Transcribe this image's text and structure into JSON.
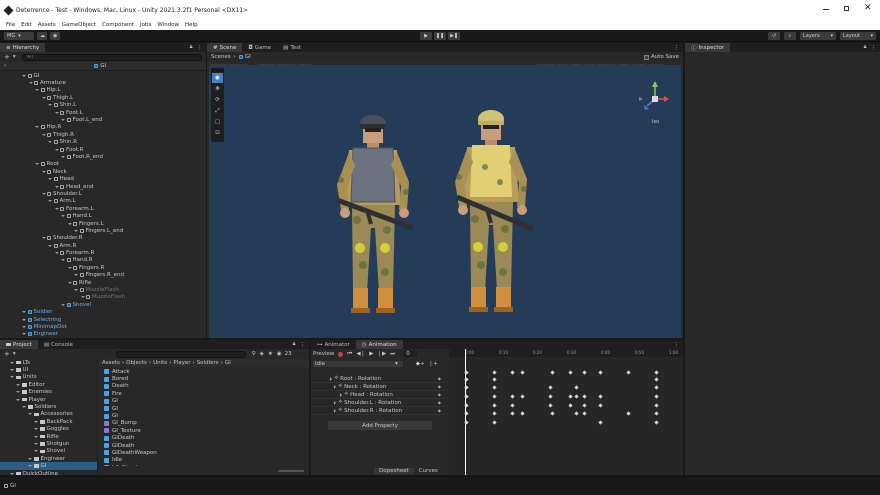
{
  "window": {
    "title": "Deterrence - Test - Windows, Mac, Linux - Unity 2021.3.2f1 Personal <DX11>"
  },
  "menu": [
    "File",
    "Edit",
    "Assets",
    "GameObject",
    "Component",
    "Jobs",
    "Window",
    "Help"
  ],
  "toolbar": {
    "account": "MG",
    "layers": "Layers",
    "layout": "Layout"
  },
  "hierarchy": {
    "tab": "Hierarchy",
    "search_placeholder": "All",
    "scene": "GI",
    "items": [
      {
        "label": "GI",
        "indent": 0,
        "icon": "cube",
        "style": ""
      },
      {
        "label": "Armature",
        "indent": 1,
        "icon": "cube",
        "style": ""
      },
      {
        "label": "Hip.L",
        "indent": 2,
        "icon": "cube",
        "style": ""
      },
      {
        "label": "Thigh.L",
        "indent": 3,
        "icon": "cube",
        "style": ""
      },
      {
        "label": "Shin.L",
        "indent": 4,
        "icon": "cube",
        "style": ""
      },
      {
        "label": "Foot.L",
        "indent": 5,
        "icon": "cube",
        "style": ""
      },
      {
        "label": "Foot.L_end",
        "indent": 6,
        "icon": "cube",
        "style": ""
      },
      {
        "label": "Hip.R",
        "indent": 2,
        "icon": "cube",
        "style": ""
      },
      {
        "label": "Thigh.R",
        "indent": 3,
        "icon": "cube",
        "style": ""
      },
      {
        "label": "Shin.R",
        "indent": 4,
        "icon": "cube",
        "style": ""
      },
      {
        "label": "Foot.R",
        "indent": 5,
        "icon": "cube",
        "style": ""
      },
      {
        "label": "Foot.R_end",
        "indent": 6,
        "icon": "cube",
        "style": ""
      },
      {
        "label": "Root",
        "indent": 2,
        "icon": "cube",
        "style": ""
      },
      {
        "label": "Neck",
        "indent": 3,
        "icon": "cube",
        "style": ""
      },
      {
        "label": "Head",
        "indent": 4,
        "icon": "cube",
        "style": ""
      },
      {
        "label": "Head_end",
        "indent": 5,
        "icon": "cube",
        "style": ""
      },
      {
        "label": "Shoulder.L",
        "indent": 3,
        "icon": "cube",
        "style": ""
      },
      {
        "label": "Arm.L",
        "indent": 4,
        "icon": "cube",
        "style": ""
      },
      {
        "label": "Forearm.L",
        "indent": 5,
        "icon": "cube",
        "style": ""
      },
      {
        "label": "Hand.L",
        "indent": 6,
        "icon": "cube",
        "style": ""
      },
      {
        "label": "Fingers.L",
        "indent": 7,
        "icon": "cube",
        "style": ""
      },
      {
        "label": "Fingers.L_end",
        "indent": 8,
        "icon": "cube",
        "style": ""
      },
      {
        "label": "Shoulder.R",
        "indent": 3,
        "icon": "cube",
        "style": ""
      },
      {
        "label": "Arm.R",
        "indent": 4,
        "icon": "cube",
        "style": ""
      },
      {
        "label": "Forearm.R",
        "indent": 5,
        "icon": "cube",
        "style": ""
      },
      {
        "label": "Hand.R",
        "indent": 6,
        "icon": "cube",
        "style": ""
      },
      {
        "label": "Fingers.R",
        "indent": 7,
        "icon": "cube",
        "style": ""
      },
      {
        "label": "Fingers.R_end",
        "indent": 8,
        "icon": "cube",
        "style": ""
      },
      {
        "label": "Rifle",
        "indent": 7,
        "icon": "cube",
        "style": ""
      },
      {
        "label": "MuzzleFlash",
        "indent": 8,
        "icon": "cube",
        "style": "dim"
      },
      {
        "label": "MuzzleFlash",
        "indent": 9,
        "icon": "cube",
        "style": "dim"
      },
      {
        "label": "Shovel",
        "indent": 6,
        "icon": "cube",
        "style": "blue"
      },
      {
        "label": "Soldier",
        "indent": 0,
        "icon": "cube",
        "style": "blue"
      },
      {
        "label": "Selectring",
        "indent": 0,
        "icon": "cube",
        "style": "blue"
      },
      {
        "label": "MinimapDot",
        "indent": 0,
        "icon": "cube",
        "style": "blue"
      },
      {
        "label": "Engineer",
        "indent": 0,
        "icon": "cube",
        "style": "blue"
      }
    ]
  },
  "scene": {
    "tabs": [
      "Scene",
      "Game",
      "Test"
    ],
    "breadcrumb": [
      "Scenes",
      "GI"
    ],
    "autosave": "Auto Save",
    "gizmo_label": "Iso"
  },
  "inspector": {
    "tab": "Inspector"
  },
  "project": {
    "tabs": [
      "Project",
      "Console"
    ],
    "tree": [
      {
        "label": "LTs",
        "indent": 1,
        "open": false
      },
      {
        "label": "UI",
        "indent": 1,
        "open": false
      },
      {
        "label": "Units",
        "indent": 1,
        "open": true
      },
      {
        "label": "Editor",
        "indent": 2,
        "open": false
      },
      {
        "label": "Enemies",
        "indent": 2,
        "open": false
      },
      {
        "label": "Player",
        "indent": 2,
        "open": true
      },
      {
        "label": "Soldiers",
        "indent": 3,
        "open": true
      },
      {
        "label": "Accessories",
        "indent": 4,
        "open": true
      },
      {
        "label": "BackPack",
        "indent": 5,
        "open": false
      },
      {
        "label": "Goggles",
        "indent": 5,
        "open": false
      },
      {
        "label": "Rifle",
        "indent": 5,
        "open": false
      },
      {
        "label": "Shotgun",
        "indent": 5,
        "open": false
      },
      {
        "label": "Shovel",
        "indent": 5,
        "open": false
      },
      {
        "label": "Engineer",
        "indent": 4,
        "open": false
      },
      {
        "label": "GI",
        "indent": 4,
        "open": false
      },
      {
        "label": "QuickOutline",
        "indent": 1,
        "open": false
      }
    ],
    "path": [
      "Assets",
      "Objects",
      "Units",
      "Player",
      "Soldiers",
      "GI"
    ],
    "files": [
      "Attack",
      "Bored",
      "Death",
      "Fire",
      "GI",
      "GI",
      "GI",
      "GI_Bump",
      "GI_Texture",
      "GIDeath",
      "GIDeath",
      "GIDeathWeapon",
      "Idle",
      "IdleShoot"
    ],
    "count": "23",
    "status": "GI"
  },
  "animation": {
    "tabs": [
      "Animator",
      "Animation"
    ],
    "preview": "Preview",
    "frame": "0",
    "clip": "Idle",
    "properties": [
      "Root : Rotation",
      "Neck : Rotation",
      "Head : Rotation",
      "Shoulder.L : Rotation",
      "Shoulder.R : Rotation"
    ],
    "add_property": "Add Property",
    "bottom_tabs": [
      "Dopesheet",
      "Curves"
    ],
    "ruler": [
      "0:00",
      "0:10",
      "0:20",
      "0:30",
      "0:40",
      "0:50",
      "1:00"
    ]
  }
}
